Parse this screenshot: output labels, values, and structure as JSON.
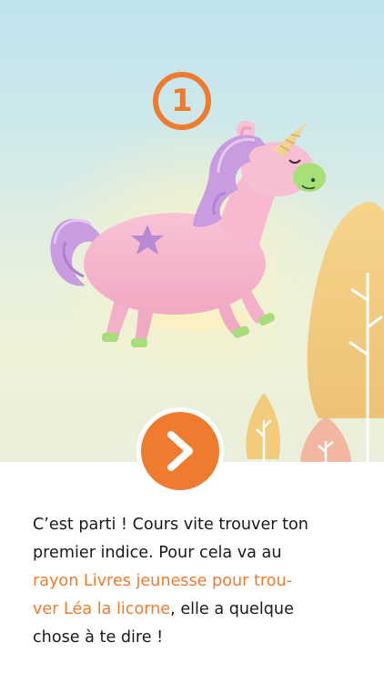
{
  "step": {
    "number": "1"
  },
  "message": {
    "intro": "C’est parti ! Cours vite trouver ton\npremier indice. Pour cela va au\n",
    "highlight": "rayon Livres jeunesse pour trou-\nver Léa la licorne",
    "outro": ", elle a quelque\nchose à te dire !"
  },
  "icons": {
    "next": "chevron-right-icon",
    "illustration": "unicorn-illustration"
  },
  "colors": {
    "accent": "#ef7b2e",
    "text": "#1a1a1a",
    "sky_top": "#bfe3ee",
    "sky_bottom": "#e9efdb",
    "unicorn_body": "#f6b9cf",
    "unicorn_mane": "#c89be0"
  }
}
